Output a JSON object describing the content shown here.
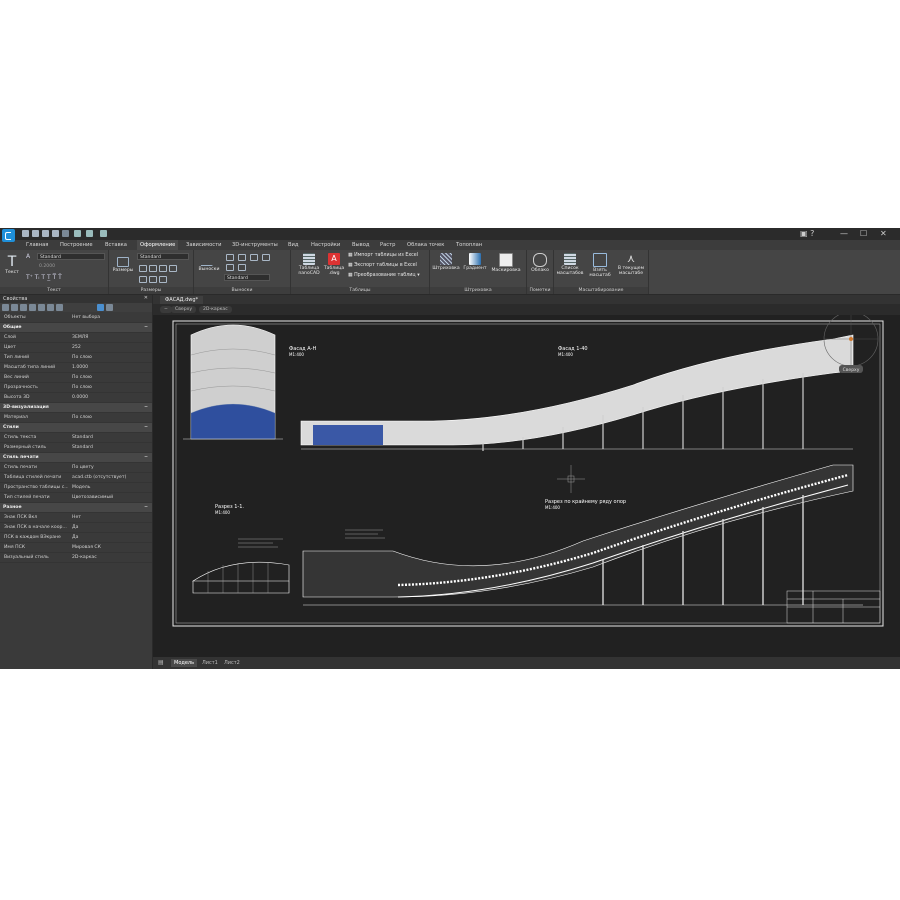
{
  "menu": {
    "tabs": [
      "Главная",
      "Построение",
      "Вставка",
      "Оформление",
      "Зависимости",
      "3D-инструменты",
      "Вид",
      "Настройки",
      "Вывод",
      "Растр",
      "Облака точек",
      "Топоплан"
    ],
    "active": "Оформление"
  },
  "ribbon": {
    "text_group": {
      "title": "Текст",
      "button": "Текст",
      "style": "Standard",
      "height": "0.2000"
    },
    "dims_group": {
      "title": "Размеры",
      "button": "Размеры",
      "style": "Standard"
    },
    "leaders_group": {
      "title": "Выноски",
      "button": "Выноски",
      "style": "Standard"
    },
    "tables_group": {
      "title": "Таблицы",
      "btn_nano": "Таблица nanoCAD",
      "btn_dwg": "Таблица .dwg",
      "import_excel": "Импорт таблицы из Excel",
      "export_excel": "Экспорт таблицы в Excel",
      "convert": "Преобразование таблиц"
    },
    "hatch_group": {
      "title": "Штриховка",
      "hatch": "Штриховка",
      "gradient": "Градиент",
      "mask": "Маскировка"
    },
    "markup_group": {
      "title": "Пометки",
      "cloud": "Облако"
    },
    "scale_group": {
      "title": "Масштабирование",
      "list": "Список масштабов",
      "take": "Взять масштаб",
      "current": "В текущем масштабе"
    }
  },
  "properties": {
    "title": "Свойства",
    "rows": [
      {
        "k": "Объекты",
        "v": "Нет выбора",
        "type": "row"
      },
      {
        "k": "Общие",
        "type": "section"
      },
      {
        "k": "Слой",
        "v": "ЗЕМЛЯ",
        "type": "row"
      },
      {
        "k": "Цвет",
        "v": "252",
        "type": "row"
      },
      {
        "k": "Тип линий",
        "v": "По слою",
        "type": "row"
      },
      {
        "k": "Масштаб типа линий",
        "v": "1.0000",
        "type": "row"
      },
      {
        "k": "Вес линий",
        "v": "По слою",
        "type": "row"
      },
      {
        "k": "Прозрачность",
        "v": "По слою",
        "type": "row"
      },
      {
        "k": "Высота 3D",
        "v": "0.0000",
        "type": "row"
      },
      {
        "k": "3D-визуализация",
        "type": "section"
      },
      {
        "k": "Материал",
        "v": "По слою",
        "type": "row"
      },
      {
        "k": "Стили",
        "type": "section"
      },
      {
        "k": "Стиль текста",
        "v": "Standard",
        "type": "row"
      },
      {
        "k": "Размерный стиль",
        "v": "Standard",
        "type": "row"
      },
      {
        "k": "Стиль печати",
        "type": "section"
      },
      {
        "k": "Стиль печати",
        "v": "По цвету",
        "type": "row"
      },
      {
        "k": "Таблица стилей печати",
        "v": "acad.ctb (отсутствует)",
        "type": "row"
      },
      {
        "k": "Пространство таблицы с...",
        "v": "Модель",
        "type": "row"
      },
      {
        "k": "Тип стилей печати",
        "v": "Цветозависимый",
        "type": "row"
      },
      {
        "k": "Разное",
        "type": "section"
      },
      {
        "k": "Знак ПСК Вкл",
        "v": "Нет",
        "type": "row"
      },
      {
        "k": "Знак ПСК в начале коор...",
        "v": "Да",
        "type": "row"
      },
      {
        "k": "ПСК в каждом ВЭкране",
        "v": "Да",
        "type": "row"
      },
      {
        "k": "Имя ПСК",
        "v": "Мировая СК",
        "type": "row"
      },
      {
        "k": "Визуальный стиль",
        "v": "2D-каркас",
        "type": "row"
      }
    ]
  },
  "document": {
    "file_tab": "ФАСАД.dwg*",
    "view_chips": [
      "−",
      "Сверху",
      "2D-каркас"
    ],
    "layout_tabs": [
      "Модель",
      "Лист1",
      "Лист2"
    ]
  },
  "drawing": {
    "facade_ah_title": "Фасад А-Н",
    "facade_ah_scale": "М1:400",
    "facade_140_title": "Фасад 1-40",
    "facade_140_scale": "М1:400",
    "section_title": "Разрез 1-1.",
    "section_scale": "М1:400",
    "section_supports_title": "Разрез по крайнему ряду опор",
    "section_supports_scale": "М1:400",
    "viewcube_label": "Сверху"
  }
}
